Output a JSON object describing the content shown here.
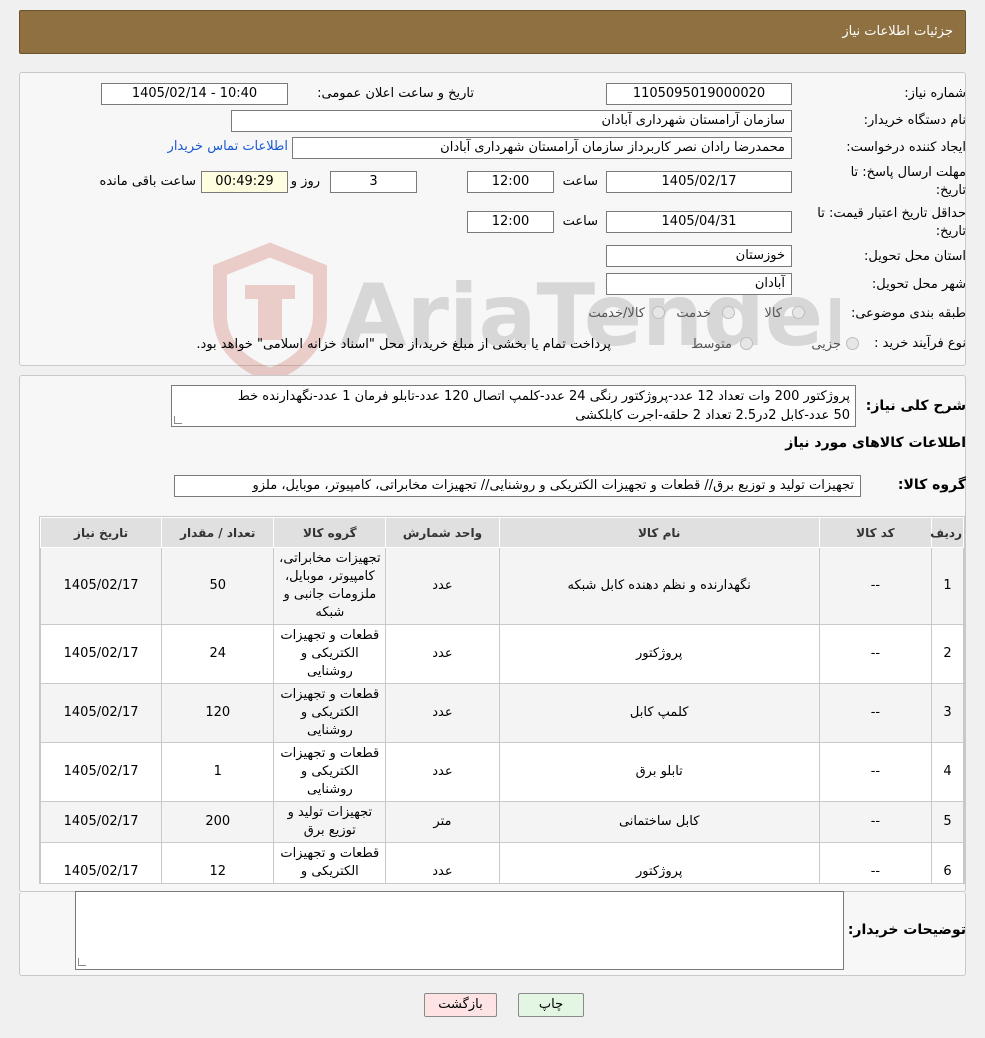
{
  "header": {
    "title": "جزئیات اطلاعات نیاز"
  },
  "form": {
    "need_number_label": "شماره نیاز:",
    "need_number": "1105095019000020",
    "announce_label": "تاریخ و ساعت اعلان عمومی:",
    "announce_value": "1405/02/14 - 10:40",
    "buyer_org_label": "نام دستگاه خریدار:",
    "buyer_org": "سازمان آرامستان شهرداری آبادان",
    "requester_label": "ایجاد کننده درخواست:",
    "requester": "محمدرضا رادان نصر کاربرداز سازمان آرامستان شهرداری آبادان",
    "contact_link": "اطلاعات تماس خریدار",
    "deadline_label_1": "مهلت ارسال پاسخ: تا",
    "deadline_label_2": "تاریخ:",
    "deadline_date": "1405/02/17",
    "time_label": "ساعت",
    "deadline_time": "12:00",
    "days_value": "3",
    "days_label": "روز و",
    "countdown": "00:49:29",
    "remaining_label": "ساعت باقی مانده",
    "validity_label_1": "حداقل تاریخ اعتبار قیمت: تا",
    "validity_label_2": "تاریخ:",
    "validity_date": "1405/04/31",
    "validity_time": "12:00",
    "province_label": "استان محل تحویل:",
    "province": "خوزستان",
    "city_label": "شهر محل تحویل:",
    "city": "آبادان",
    "category_label": "طبقه بندی موضوعی:",
    "category_options": [
      "کالا",
      "خدمت",
      "کالا/خدمت"
    ],
    "process_label": "نوع فرآیند خرید :",
    "process_options": [
      "جزیی",
      "متوسط"
    ],
    "process_note": "پرداخت تمام یا بخشی از مبلغ خرید،از محل \"اسناد خزانه اسلامی\" خواهد بود."
  },
  "summary": {
    "label": "شرح کلی نیاز:",
    "line1": "پروژکتور 200 وات تعداد 12 عدد-پروژکتور رنگی 24 عدد-کلمپ اتصال 120 عدد-تابلو فرمان  1 عدد-نگهدارنده  خط",
    "line2": "50 عدد-کابل 2در2.5 تعداد 2 حلقه-اجرت کابلکشی",
    "items_title": "اطلاعات کالاهای مورد نیاز",
    "group_label": "گروه کالا:",
    "group_value": "تجهیزات تولید و توزیع برق// قطعات و تجهیزات الکتریکی و روشنایی// تجهیزات مخابراتی، کامپیوتر، موبایل، ملزو"
  },
  "table": {
    "headers": [
      "ردیف",
      "کد کالا",
      "نام کالا",
      "واحد شمارش",
      "گروه کالا",
      "تعداد / مقدار",
      "تاریخ نیاز"
    ],
    "rows": [
      {
        "row": "1",
        "code": "--",
        "name": "نگهدارنده و نظم دهنده کابل شبکه",
        "unit": "عدد",
        "group": "تجهیزات مخابراتی، کامپیوتر، موبایل، ملزومات جانبی و شبکه",
        "qty": "50",
        "date": "1405/02/17"
      },
      {
        "row": "2",
        "code": "--",
        "name": "پروژکتور",
        "unit": "عدد",
        "group": "قطعات و تجهیزات الکتریکی و روشنایی",
        "qty": "24",
        "date": "1405/02/17"
      },
      {
        "row": "3",
        "code": "--",
        "name": "کلمپ کابل",
        "unit": "عدد",
        "group": "قطعات و تجهیزات الکتریکی و روشنایی",
        "qty": "120",
        "date": "1405/02/17"
      },
      {
        "row": "4",
        "code": "--",
        "name": "تابلو برق",
        "unit": "عدد",
        "group": "قطعات و تجهیزات الکتریکی و روشنایی",
        "qty": "1",
        "date": "1405/02/17"
      },
      {
        "row": "5",
        "code": "--",
        "name": "کابل ساختمانی",
        "unit": "متر",
        "group": "تجهیزات تولید و توزیع برق",
        "qty": "200",
        "date": "1405/02/17"
      },
      {
        "row": "6",
        "code": "--",
        "name": "پروژکتور",
        "unit": "عدد",
        "group": "قطعات و تجهیزات الکتریکی و روشنایی",
        "qty": "12",
        "date": "1405/02/17"
      }
    ]
  },
  "notes": {
    "label": "توضیحات خریدار:",
    "value": ""
  },
  "buttons": {
    "print": "چاپ",
    "back": "بازگشت"
  },
  "watermark": {
    "text": "AriaTender.neT"
  },
  "colors": {
    "header_bg": "#8e7041",
    "link": "#1a5ad6",
    "back_button": "#fde3e3",
    "print_button": "#e3f6e3"
  }
}
